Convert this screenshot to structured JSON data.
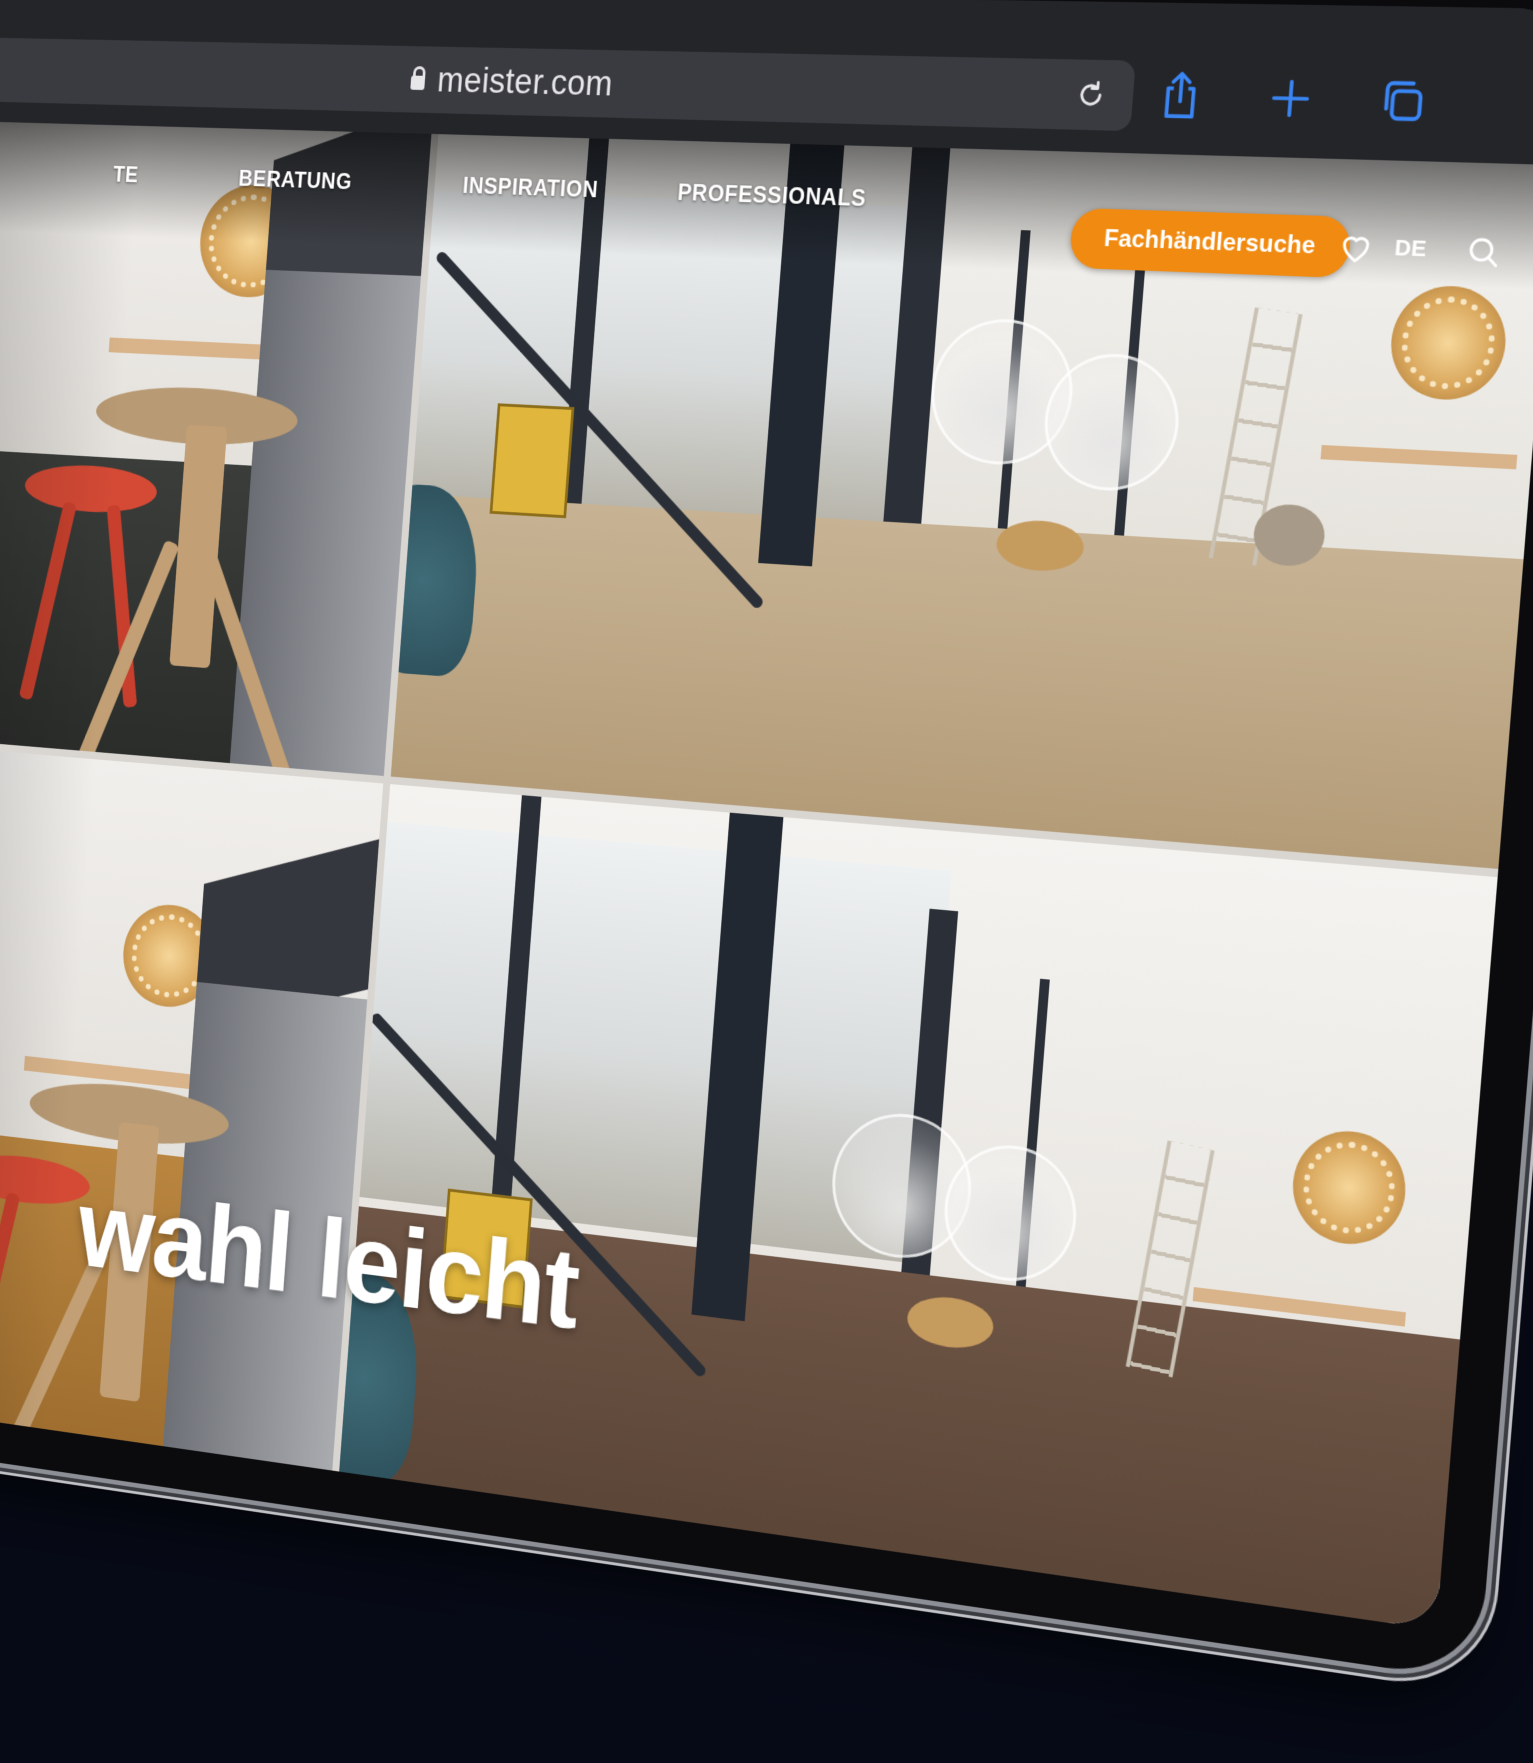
{
  "browser": {
    "url": "meister.com",
    "icons": [
      "lock-icon",
      "reload-icon",
      "share-icon",
      "new-tab-icon",
      "tabs-icon"
    ]
  },
  "nav": {
    "items": [
      "TE",
      "BERATUNG",
      "INSPIRATION",
      "PROFESSIONALS"
    ],
    "cta_label": "Fachhändlersuche",
    "language": "DE",
    "icons": [
      "heart-icon",
      "search-icon"
    ],
    "cta_color": "#f08a11"
  },
  "hero": {
    "headline": "wahl leicht"
  }
}
